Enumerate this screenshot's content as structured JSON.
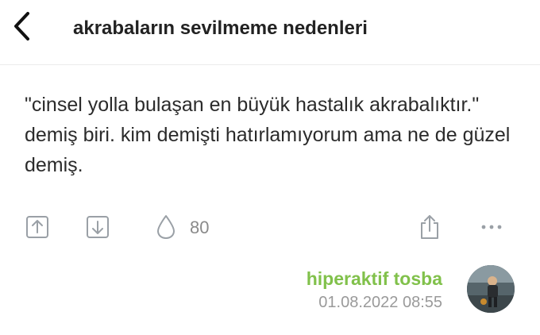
{
  "header": {
    "title": "akrabaların sevilmeme nedenleri",
    "back_icon": "chevron-left-icon"
  },
  "entry": {
    "text": "\"cinsel yolla bulaşan en büyük hastalık akrabalıktır.\" demiş biri. kim demişti hatırlamıyorum ama ne de güzel demiş."
  },
  "toolbar": {
    "upvote_icon": "upvote-icon",
    "downvote_icon": "downvote-icon",
    "drop_icon": "drop-icon",
    "vote_count": "80",
    "share_icon": "share-icon",
    "more_icon": "more-icon"
  },
  "author": {
    "name": "hiperaktif tosba",
    "date": "01.08.2022 08:55"
  },
  "colors": {
    "author_green": "#81c14b",
    "icon_gray": "#9aa0a6",
    "text_dark": "#2b2b2b"
  }
}
